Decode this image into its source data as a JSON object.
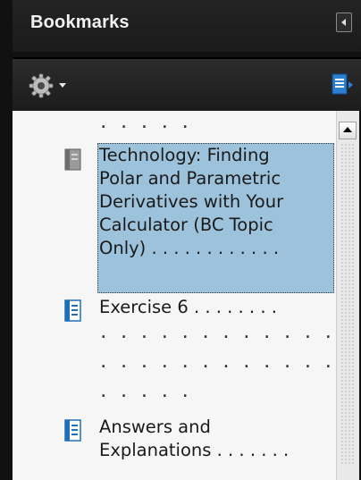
{
  "panel": {
    "title": "Bookmarks"
  },
  "toolbar": {
    "options_icon": "gear-icon",
    "expand_icon": "expand-current-bookmark-icon"
  },
  "bookmarks": {
    "top_leader": ". . . . .",
    "items": [
      {
        "lines": [
          "Technology: Finding",
          "Polar and Parametric",
          "Derivatives with Your",
          "Calculator (BC Topic",
          "Only) . . . . . . . . . . . ."
        ],
        "selected": true,
        "icon": "bookmark-page-icon-gray"
      },
      {
        "lines": [
          "Exercise 6 . . . . . . . ."
        ],
        "leaders": [
          ". . . . . . . . . . . . . . . .",
          ". . . . . . . . . . . . . . . .",
          ". . . . ."
        ],
        "selected": false,
        "icon": "bookmark-page-icon-blue"
      },
      {
        "lines": [
          "Answers and",
          "Explanations . . . . . . ."
        ],
        "selected": false,
        "icon": "bookmark-page-icon-blue"
      }
    ]
  },
  "colors": {
    "selection": "#9dc3dc",
    "panel_bg": "#111111",
    "content_bg": "#f6f6f6",
    "icon_blue": "#1f6fb8"
  }
}
